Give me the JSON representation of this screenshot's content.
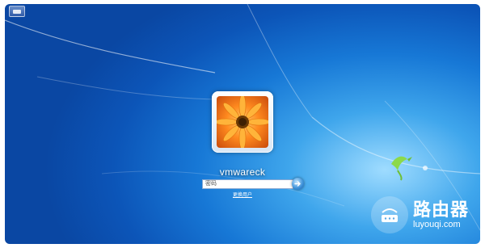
{
  "login": {
    "username": "vmwareck",
    "password_placeholder": "密码",
    "switch_user_label": "更换用户"
  },
  "watermark": {
    "brand": "路由器",
    "url": "luyouqi.com"
  },
  "icons": {
    "avatar": "flower-avatar-icon",
    "submit": "arrow-right-icon",
    "corner": "ease-of-access-icon",
    "bird": "windows-bird-icon",
    "logo": "router-logo-icon"
  },
  "colors": {
    "wallpaper_dark": "#0a47a3",
    "wallpaper_light": "#9fdcff",
    "flower_orange": "#ff8a1f",
    "bird_green": "#8cd94a"
  }
}
